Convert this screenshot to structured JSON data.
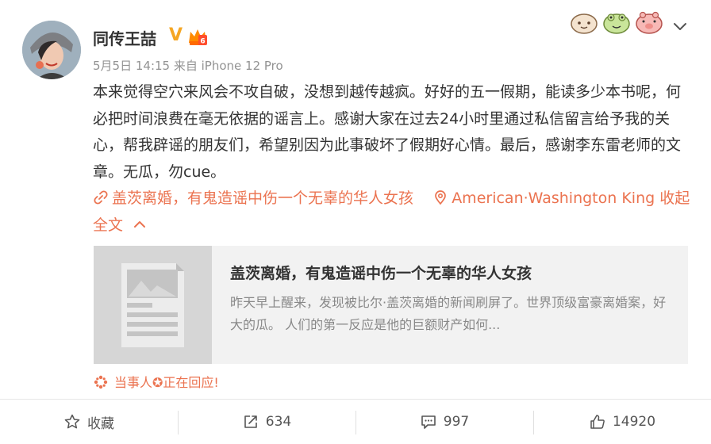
{
  "post": {
    "username": "同传王喆",
    "verified_mark": "V",
    "meta": "5月5日 14:15 来自 iPhone 12 Pro",
    "body": "本来觉得空穴来风会不攻自破，没想到越传越疯。好好的五一假期，能读多少本书呢，何必把时间浪费在毫无依据的谣言上。感谢大家在过去24小时里通过私信留言给予我的关心，帮我辟谣的朋友们，希望别因为此事破坏了假期好心情。最后，感谢李东雷老师的文章。无瓜，勿cue。",
    "article_link": "盖茨离婚，有鬼造谣中伤一个无辜的华人女孩",
    "location_link": "American·Washington King",
    "collapse_label": "收起全文"
  },
  "card": {
    "title": "盖茨离婚，有鬼造谣中伤一个无辜的华人女孩",
    "description": "昨天早上醒来，发现被比尔·盖茨离婚的新闻刷屏了。世界顶级富豪离婚案，好大的瓜。 人们的第一反应是他的巨额财产如何..."
  },
  "notice": {
    "text": "当事人✪正在回应!"
  },
  "actions": {
    "favorite_label": "收藏",
    "repost_count": "634",
    "comment_count": "997",
    "like_count": "14920"
  },
  "colors": {
    "link": "#eb7350",
    "verified": "#f5a623",
    "text": "#333333",
    "muted": "#939393"
  },
  "icons": [
    "star-icon",
    "repost-icon",
    "comment-icon",
    "thumbs-up-icon",
    "link-icon",
    "location-pin-icon",
    "chevron-up-icon",
    "chevron-down-icon"
  ]
}
